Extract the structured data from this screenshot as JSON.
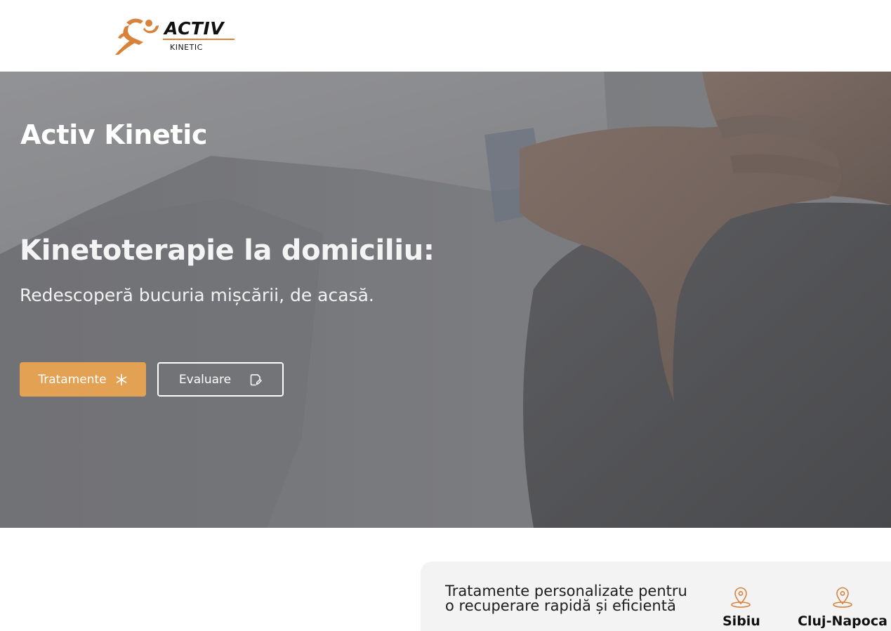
{
  "header": {
    "logo": {
      "word": "ACTIV",
      "sub": "KINETIC"
    }
  },
  "hero": {
    "brand_title": "Activ Kinetic",
    "heading": "Kinetoterapie la domiciliu:",
    "subheading": "Redescoperă bucuria mișcării, de acasă.",
    "buttons": {
      "primary_label": "Tratamente",
      "primary_icon": "asterisk-icon",
      "secondary_label": "Evaluare",
      "secondary_icon": "edit-note-icon"
    }
  },
  "info": {
    "text": "Tratamente personalizate pentru o recuperare rapidă și eficientă",
    "locations": [
      {
        "label": "Sibiu",
        "icon": "map-pin-icon"
      },
      {
        "label": "Cluj-Napoca",
        "icon": "map-pin-icon"
      }
    ]
  },
  "colors": {
    "accent": "#e3a153",
    "logo_orange": "#d9823b",
    "card_bg": "#f3f3f3"
  }
}
